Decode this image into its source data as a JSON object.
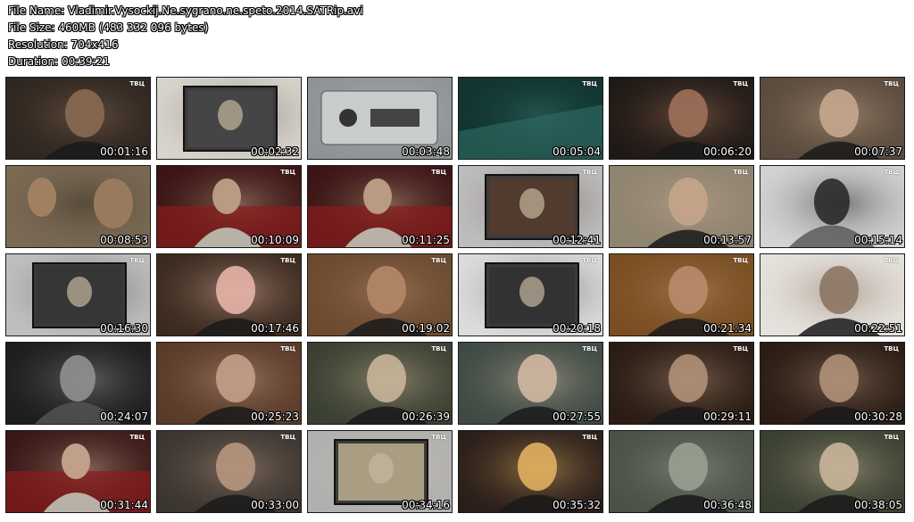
{
  "header": {
    "file_name": "File Name: Vladimir.Vysockij.Ne.sygrano.ne.speto.2014.SATRip.avi",
    "file_size": "File Size: 460MB (483 332 096 bytes)",
    "resolution": "Resolution: 704x416",
    "duration": "Duration: 00:39:21"
  },
  "thumbnails": [
    {
      "time": "00:01:16",
      "logo": "ТВЦ",
      "bg": "#2e2620",
      "fg": "#8a6a52",
      "style": "face"
    },
    {
      "time": "00:02:32",
      "logo": "",
      "bg": "#d8d4cc",
      "fg": "#4a4a4a",
      "style": "frame"
    },
    {
      "time": "00:03:48",
      "logo": "",
      "bg": "#8e9396",
      "fg": "#c9cccc",
      "style": "device"
    },
    {
      "time": "00:05:04",
      "logo": "ТВЦ",
      "bg": "#12332f",
      "fg": "#2f6e66",
      "style": "dark"
    },
    {
      "time": "00:06:20",
      "logo": "ТВЦ",
      "bg": "#1f1915",
      "fg": "#a0705a",
      "style": "face"
    },
    {
      "time": "00:07:37",
      "logo": "ТВЦ",
      "bg": "#5a4b3d",
      "fg": "#c7a78d",
      "style": "face"
    },
    {
      "time": "00:08:53",
      "logo": "",
      "bg": "#7a6a54",
      "fg": "#3b3024",
      "style": "sepia"
    },
    {
      "time": "00:10:09",
      "logo": "ТВЦ",
      "bg": "#3a1414",
      "fg": "#b99a82",
      "style": "seats"
    },
    {
      "time": "00:11:25",
      "logo": "ТВЦ",
      "bg": "#3a1414",
      "fg": "#b99a82",
      "style": "seats"
    },
    {
      "time": "00:12:41",
      "logo": "ТВЦ",
      "bg": "#bdbdbd",
      "fg": "#5b3a2a",
      "style": "frame"
    },
    {
      "time": "00:13:57",
      "logo": "ТВЦ",
      "bg": "#8e8470",
      "fg": "#c5a58b",
      "style": "face"
    },
    {
      "time": "00:15:14",
      "logo": "ТВЦ",
      "bg": "#d3d3d3",
      "fg": "#2a2a2a",
      "style": "bw"
    },
    {
      "time": "00:16:30",
      "logo": "ТВЦ",
      "bg": "#bfbfbf",
      "fg": "#353535",
      "style": "frame"
    },
    {
      "time": "00:17:46",
      "logo": "ТВЦ",
      "bg": "#3b2a1e",
      "fg": "#e6b4a8",
      "style": "face"
    },
    {
      "time": "00:19:02",
      "logo": "ТВЦ",
      "bg": "#6b4a30",
      "fg": "#b48868",
      "style": "face"
    },
    {
      "time": "00:20:18",
      "logo": "ТВЦ",
      "bg": "#dcdcdc",
      "fg": "#2f2f2f",
      "style": "frame"
    },
    {
      "time": "00:21:34",
      "logo": "ТВЦ",
      "bg": "#7a4e22",
      "fg": "#b88c6b",
      "style": "face"
    },
    {
      "time": "00:22:51",
      "logo": "ТВЦ",
      "bg": "#e5e2dd",
      "fg": "#8c7563",
      "style": "face"
    },
    {
      "time": "00:24:07",
      "logo": "",
      "bg": "#1d1d1d",
      "fg": "#909090",
      "style": "bw"
    },
    {
      "time": "00:25:23",
      "logo": "ТВЦ",
      "bg": "#5a3a28",
      "fg": "#c3a08a",
      "style": "face"
    },
    {
      "time": "00:26:39",
      "logo": "ТВЦ",
      "bg": "#3a4031",
      "fg": "#c9b59a",
      "style": "face"
    },
    {
      "time": "00:27:55",
      "logo": "ТВЦ",
      "bg": "#3e4a44",
      "fg": "#d0b8a2",
      "style": "face"
    },
    {
      "time": "00:29:11",
      "logo": "ТВЦ",
      "bg": "#2a1c14",
      "fg": "#b09078",
      "style": "face"
    },
    {
      "time": "00:30:28",
      "logo": "ТВЦ",
      "bg": "#2a1c14",
      "fg": "#b09078",
      "style": "face"
    },
    {
      "time": "00:31:44",
      "logo": "ТВЦ",
      "bg": "#3a1616",
      "fg": "#c0a088",
      "style": "seats"
    },
    {
      "time": "00:33:00",
      "logo": "ТВЦ",
      "bg": "#3b3530",
      "fg": "#b69680",
      "style": "face"
    },
    {
      "time": "00:34:16",
      "logo": "ТВЦ",
      "bg": "#b0b0b0",
      "fg": "#d9c9a0",
      "style": "frame"
    },
    {
      "time": "00:35:32",
      "logo": "ТВЦ",
      "bg": "#2a1e1a",
      "fg": "#e0b060",
      "style": "face"
    },
    {
      "time": "00:36:48",
      "logo": "",
      "bg": "#4a5248",
      "fg": "#9aa090",
      "style": "face"
    },
    {
      "time": "00:38:05",
      "logo": "ТВЦ",
      "bg": "#3a4031",
      "fg": "#c9b59a",
      "style": "face"
    }
  ]
}
